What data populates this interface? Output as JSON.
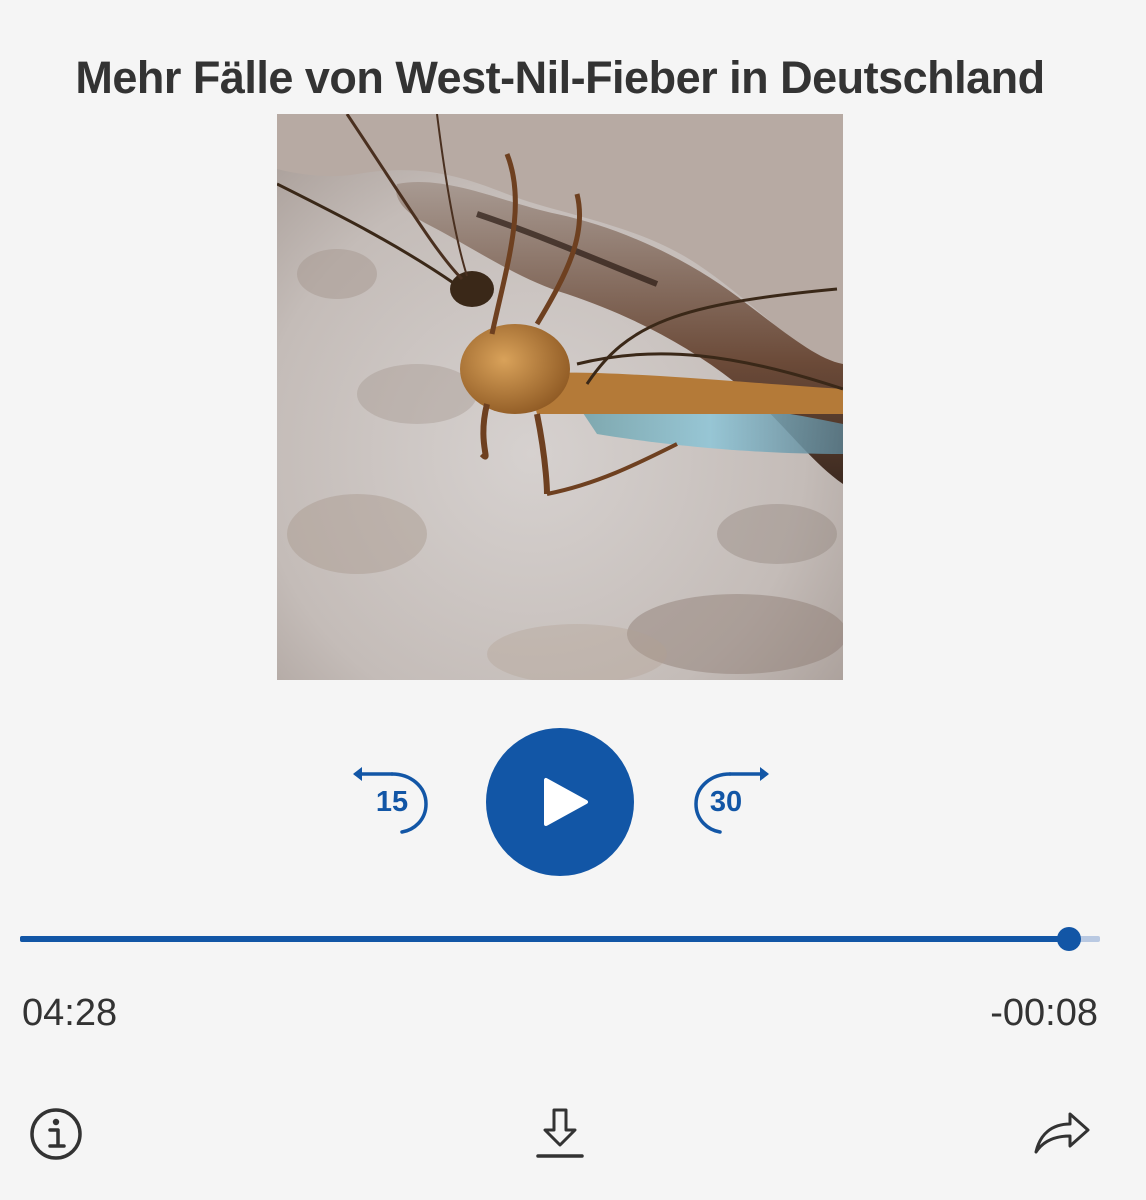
{
  "episode": {
    "title": "Mehr Fälle von West-Nil-Fieber in Deutschland"
  },
  "artwork": {
    "icon": "mosquito-cover-image"
  },
  "controls": {
    "skip_back_label": "15",
    "skip_forward_label": "30",
    "play_icon": "play-icon",
    "accent_color": "#1256a6"
  },
  "progress": {
    "elapsed": "04:28",
    "remaining": "-00:08",
    "fraction": 0.971
  },
  "actions": {
    "info_icon": "info-icon",
    "download_icon": "download-icon",
    "share_icon": "share-icon"
  }
}
